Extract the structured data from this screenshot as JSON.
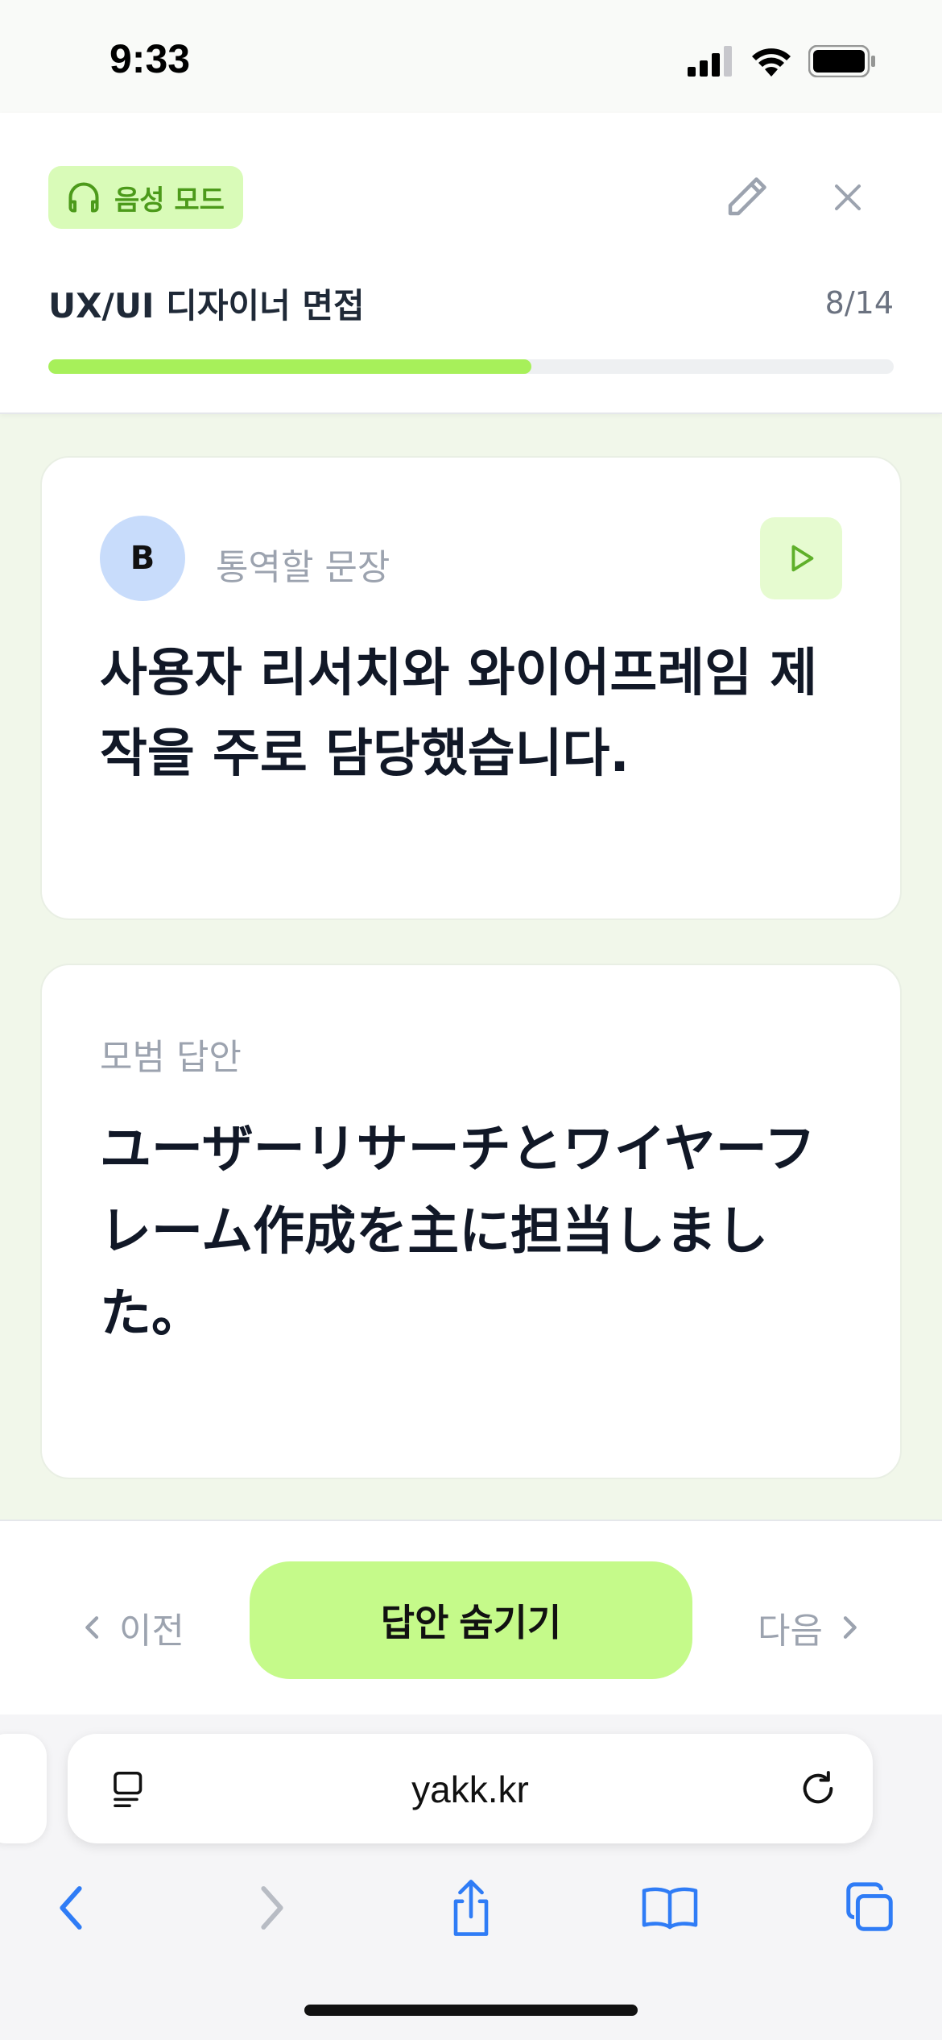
{
  "status_bar": {
    "time": "9:33"
  },
  "header": {
    "mode_badge": "음성 모드",
    "title": "UX/UI 디자이너 면접",
    "progress_text": "8/14",
    "progress_fraction": 0.571
  },
  "question_card": {
    "speaker_initial": "B",
    "label": "통역할 문장",
    "text": "사용자 리서치와 와이어프레임 제작을 주로 담당했습니다."
  },
  "answer_card": {
    "label": "모범 답안",
    "text": "ユーザーリサーチとワイヤーフレーム作成を主に担当しました。"
  },
  "actions": {
    "prev_label": "이전",
    "primary_label": "답안 숨기기",
    "next_label": "다음"
  },
  "browser": {
    "address": "yakk.kr"
  },
  "colors": {
    "accent": "#c5fa8a",
    "progress": "#a7f05a",
    "badge_bg": "#d9fbb8",
    "badge_text": "#4c9a1a",
    "background": "#f1f7ea",
    "ios_blue": "#2f7cf6"
  }
}
